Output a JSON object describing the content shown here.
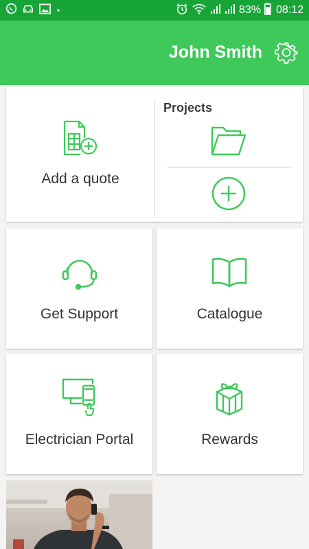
{
  "status_bar": {
    "battery": "83%",
    "time": "08:12",
    "left_icons": [
      "whatsapp-icon",
      "car-icon",
      "image-icon",
      "dot-icon"
    ],
    "right_icons": [
      "alarm-icon",
      "wifi-icon",
      "signal-icon",
      "signal-icon",
      "battery-icon"
    ]
  },
  "header": {
    "user_name": "John Smith",
    "settings_icon": "gear-icon"
  },
  "tiles": {
    "add_quote": {
      "label": "Add a quote",
      "icon": "quote-calculator-add-icon"
    },
    "projects": {
      "title": "Projects",
      "folder_icon": "folder-icon",
      "add_icon": "add-circle-icon"
    },
    "support": {
      "label": "Get Support",
      "icon": "headset-icon"
    },
    "catalogue": {
      "label": "Catalogue",
      "icon": "book-icon"
    },
    "electrician_portal": {
      "label": "Electrician Portal",
      "icon": "devices-icon"
    },
    "rewards": {
      "label": "Rewards",
      "icon": "gift-icon"
    }
  },
  "colors": {
    "status_bar": "#17a537",
    "app_bar": "#3ec95a",
    "accent": "#3ec95a",
    "text": "#333333"
  }
}
